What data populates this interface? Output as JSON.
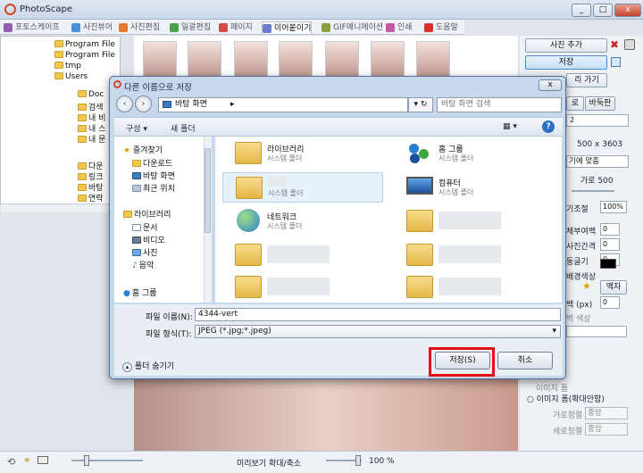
{
  "app": {
    "title": "PhotoScape",
    "win_buttons": [
      "_",
      "□",
      "x"
    ]
  },
  "tabs": [
    {
      "label": "포토스케이프",
      "color": "#8f5fb4"
    },
    {
      "label": "사진뷰어",
      "color": "#4a90d9"
    },
    {
      "label": "사진편집",
      "color": "#e57a2b"
    },
    {
      "label": "일괄편집",
      "color": "#4aa34a"
    },
    {
      "label": "페이지",
      "color": "#d14b4b"
    },
    {
      "label": "이어붙이기",
      "color": "#6b7cc9",
      "active": true
    },
    {
      "label": "GIF애니메이션",
      "color": "#8aa13f"
    },
    {
      "label": "인쇄",
      "color": "#c05a9c"
    },
    {
      "label": "도움말",
      "color": "#d93030"
    }
  ],
  "tree": {
    "items": [
      "Program File",
      "Program File",
      "tmp",
      "Users",
      "Doc",
      "검색",
      "내 비",
      "내 스",
      "내 문",
      "다운",
      "링크",
      "바탕",
      "연락"
    ]
  },
  "right_panel": {
    "add_photo": "사진 추가",
    "save": "저장",
    "row3": "리 가기",
    "tab_a": "로",
    "tab_b": "바둑판",
    "dim": "500 x 3603",
    "fit": "기에 맞춤",
    "width_label": "가로 500",
    "size_adjust": "기조절",
    "pct": "100%",
    "labels": [
      "체부여백",
      "사진간격",
      "둥글기",
      "배경색상"
    ],
    "values": [
      "0",
      "0",
      "0"
    ],
    "text_btn": "액자",
    "margin_label": "백 (px)",
    "margin_value": "0",
    "line_color": "백 색상",
    "option1": "이미지 폼",
    "option2": "이미지 폼(확대안함)",
    "align_h_label": "가로정렬",
    "align_h": "중앙",
    "align_v_label": "세로정렬",
    "align_v": "중앙"
  },
  "bottom": {
    "zoom_label": "미리보기 확대/축소",
    "zoom_value": "100 %"
  },
  "dialog": {
    "title": "다른 이름으로 저장",
    "close": "x",
    "address": "바탕 화면",
    "search_placeholder": "바탕 화면 검색",
    "organize": "구성 ▾",
    "new_folder": "새 폴더",
    "help": "?",
    "nav": {
      "favorites": "즐겨찾기",
      "fav_items": [
        "다운로드",
        "바탕 화면",
        "최근 위치"
      ],
      "libraries": "라이브러리",
      "lib_items": [
        "문서",
        "비디오",
        "사진",
        "음악"
      ],
      "homegroup": "홈 그룹"
    },
    "files": [
      {
        "name": "라이브러리",
        "sub": "시스템 폴더",
        "kind": "folder"
      },
      {
        "name": "홈 그룹",
        "sub": "시스템 폴더",
        "kind": "homegroup"
      },
      {
        "name": "",
        "sub": "시스템 폴더",
        "kind": "user"
      },
      {
        "name": "컴퓨터",
        "sub": "시스템 폴더",
        "kind": "computer"
      },
      {
        "name": "네트워크",
        "sub": "시스템 폴더",
        "kind": "network"
      }
    ],
    "filename_label": "파일 이름(N):",
    "filename": "4344-vert",
    "filetype_label": "파일 형식(T):",
    "filetype": "JPEG (*.jpg;*.jpeg)",
    "hide_folders": "폴더 숨기기",
    "save_btn": "저장(S)",
    "cancel_btn": "취소"
  }
}
